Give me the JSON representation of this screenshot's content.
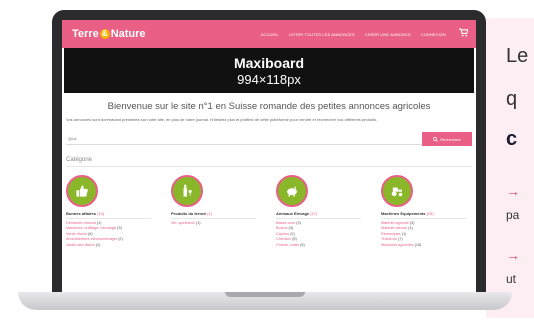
{
  "side_panel": {
    "line1": "Le",
    "line2": "q",
    "line3": "c",
    "bullet1_arrow": "→",
    "bullet1_text": "pa",
    "bullet2_arrow": "→",
    "bullet2_text": "ut"
  },
  "site": {
    "logo_part1": "Terre",
    "logo_amp": "&",
    "logo_part2": "Nature",
    "nav": [
      "ACCUEIL",
      "LISTER TOUTES LES ANNONCES",
      "CRÉER UNE ANNONCE",
      "CONNEXION"
    ],
    "cart_icon": "cart-icon",
    "ad": {
      "title": "Maxiboard",
      "size": "994×118px"
    },
    "welcome": "Bienvenue sur le site n°1 en Suisse romande des petites annonces agricoles",
    "subwelcome": "Vos annonces sont dorénavant présentes sur notre site, en plus de notre journal. N'hésitez plus et profitez de cette plateforme pour vendre et rechercher vos différents produits.",
    "search": {
      "placeholder": "Quoi",
      "button": "Rechercher"
    },
    "category_label": "Catégorie",
    "categories": [
      {
        "icon": "👍",
        "title": "Bonnes affaires",
        "count": "(13)",
        "items": [
          {
            "label": "Demande d'achat",
            "count": "(1)"
          },
          {
            "label": "Machines, outillage, bricolage",
            "count": "(3)"
          },
          {
            "label": "Vente divers",
            "count": "(6)"
          },
          {
            "label": "Ameublement-électroménager",
            "count": "(2)"
          },
          {
            "label": "Jardin des divers",
            "count": "(1)"
          }
        ]
      },
      {
        "icon": "🍷",
        "title": "Produits du terroir",
        "count": "(1)",
        "items": [
          {
            "label": "Vin, spiritueux",
            "count": "(1)"
          }
        ]
      },
      {
        "icon": "🐖",
        "title": "Animaux Elevage",
        "count": "(27)",
        "items": [
          {
            "label": "Basse-cour",
            "count": "(3)"
          },
          {
            "label": "Bovins",
            "count": "(3)"
          },
          {
            "label": "Caprins",
            "count": "(2)"
          },
          {
            "label": "Chevaux",
            "count": "(5)"
          },
          {
            "label": "Chiens, chats",
            "count": "(5)"
          }
        ]
      },
      {
        "icon": "🚜",
        "title": "Machines Equipements",
        "count": "(25)",
        "items": [
          {
            "label": "Matériel agricole",
            "count": "(3)"
          },
          {
            "label": "Matériel viticole",
            "count": "(1)"
          },
          {
            "label": "Remorques",
            "count": "(1)"
          },
          {
            "label": "Tracteurs",
            "count": "(7)"
          },
          {
            "label": "Machines agricoles",
            "count": "(10)"
          }
        ]
      }
    ]
  },
  "colors": {
    "brand": "#e95f86",
    "category": "#8ab62a"
  }
}
